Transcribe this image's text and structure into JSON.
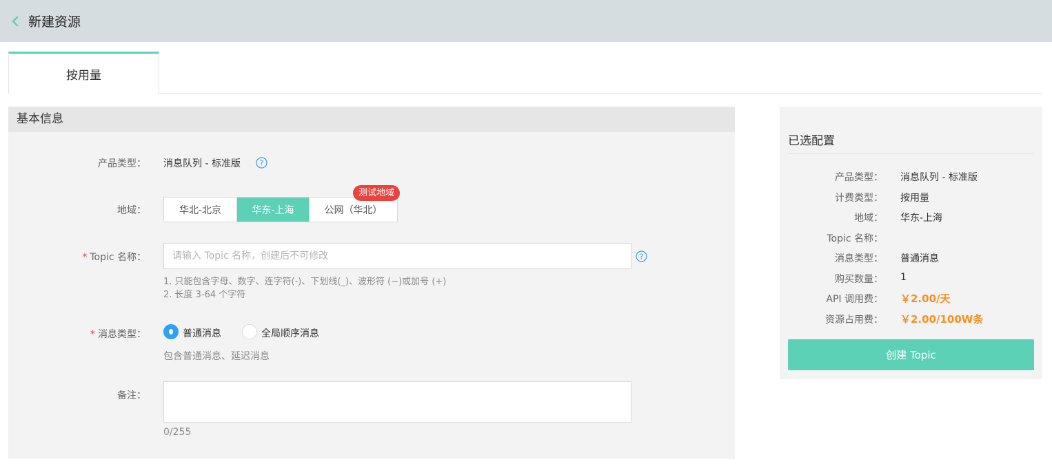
{
  "header": {
    "title": "新建资源"
  },
  "tabs": [
    {
      "label": "按用量",
      "active": true
    }
  ],
  "basic_info": {
    "section_title": "基本信息",
    "product_type": {
      "label": "产品类型：",
      "value": "消息队列 - 标准版"
    },
    "region": {
      "label": "地域：",
      "options": [
        "华北-北京",
        "华东-上海",
        "公网（华北）"
      ],
      "selected": "华东-上海",
      "badge": "测试地域"
    },
    "topic_name": {
      "required_mark": "*",
      "label": "Topic 名称：",
      "value": "",
      "placeholder": "请输入 Topic 名称，创建后不可修改",
      "hints": [
        "1. 只能包含字母、数字、连字符(-)、下划线(_)、波形符 (~)或加号 (+)",
        "2. 长度 3-64 个字符"
      ]
    },
    "message_type": {
      "required_mark": "*",
      "label": "消息类型：",
      "options": [
        "普通消息",
        "全局顺序消息"
      ],
      "selected": "普通消息",
      "hint": "包含普通消息、延迟消息"
    },
    "remark": {
      "label": "备注：",
      "value": "",
      "counter": "0/255"
    }
  },
  "summary": {
    "title": "已选配置",
    "rows": [
      {
        "label": "产品类型：",
        "value": "消息队列 - 标准版"
      },
      {
        "label": "计费类型：",
        "value": "按用量"
      },
      {
        "label": "地域：",
        "value": "华东-上海"
      },
      {
        "label": "Topic 名称：",
        "value": ""
      },
      {
        "label": "消息类型：",
        "value": "普通消息"
      },
      {
        "label": "购买数量：",
        "value": "1"
      },
      {
        "label": "API 调用费：",
        "value": "￥2.00/天"
      },
      {
        "label": "资源占用费：",
        "value": "￥2.00/100W条"
      }
    ],
    "create_button": "创建 Topic"
  },
  "colors": {
    "accent": "#5dd1b5",
    "radio_checked": "#2da3ef",
    "badge": "#e8433f",
    "price": "#f79020",
    "required": "#e8433f"
  },
  "icons": {
    "back": "chevron-left-icon",
    "help": "question-circle-icon"
  }
}
